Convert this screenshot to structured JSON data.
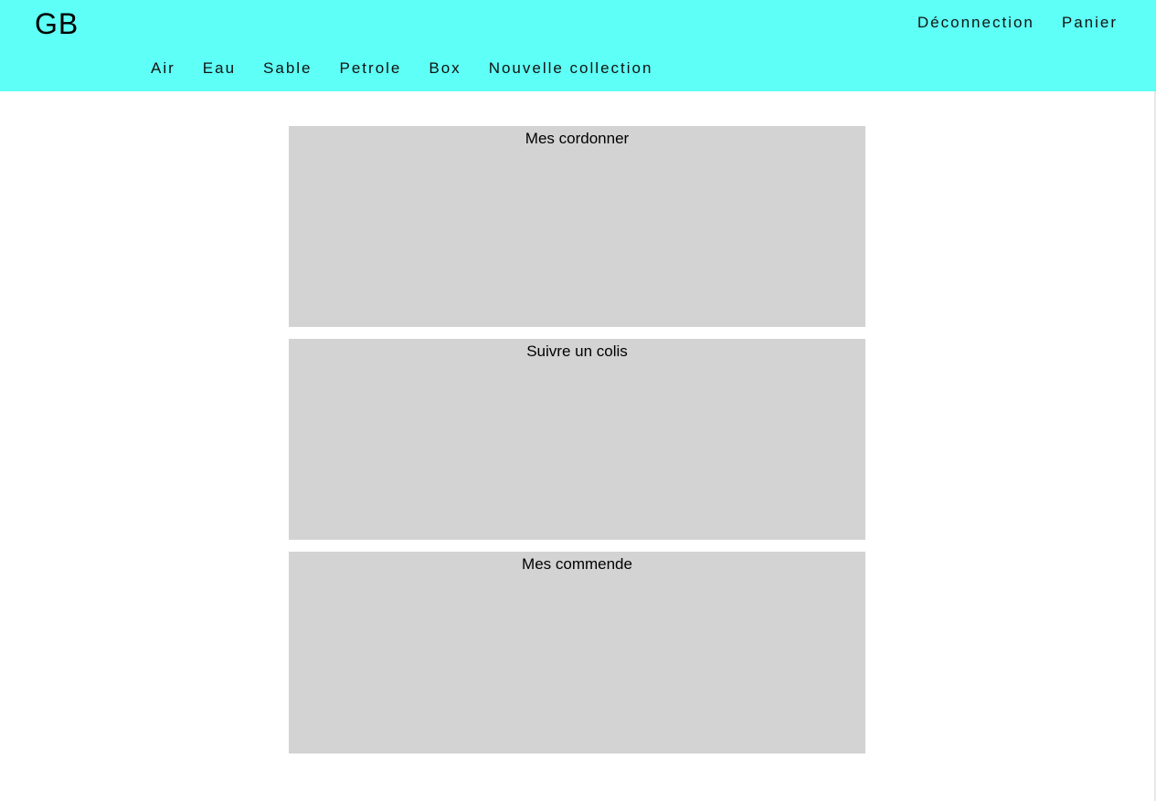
{
  "header": {
    "logo": "GB",
    "background_color": "#5efff6",
    "top_links": [
      {
        "label": "Déconnection"
      },
      {
        "label": "Panier"
      }
    ],
    "nav": [
      {
        "label": "Air"
      },
      {
        "label": "Eau"
      },
      {
        "label": "Sable"
      },
      {
        "label": "Petrole"
      },
      {
        "label": "Box"
      },
      {
        "label": "Nouvelle collection"
      }
    ]
  },
  "main": {
    "panel_color": "#d3d3d3",
    "panels": [
      {
        "title": "Mes cordonner"
      },
      {
        "title": "Suivre un colis"
      },
      {
        "title": "Mes commende"
      }
    ]
  }
}
